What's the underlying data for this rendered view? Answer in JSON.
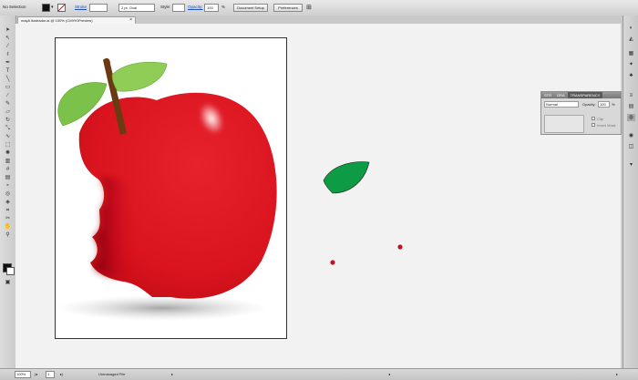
{
  "control_bar": {
    "selection_label": "No Selection",
    "stroke_label": "Stroke",
    "brush_value": "2 pt. Oval",
    "style_label": "Style:",
    "opacity_label": "Opacity:",
    "opacity_value": "100",
    "percent": "%",
    "document_setup": "Document Setup",
    "preferences": "Preferences"
  },
  "document_tab": {
    "title": "maçã ilustrador.ai @ 100% (CMYK/Preview)",
    "close": "×"
  },
  "transparency_panel": {
    "tabs": [
      "STR",
      "GRA",
      "TRANSPARENCY"
    ],
    "mode": "Normal",
    "opacity_label": "Opacity:",
    "opacity_value": "100",
    "percent": "%",
    "clip_label": "Clip",
    "invert_mask_label": "Invert Mask"
  },
  "status_bar": {
    "zoom": "100%",
    "page": "1",
    "file_status": "Unmanaged File"
  },
  "colors": {
    "apple_red": "#d9141f",
    "apple_shadow": "#8e0008",
    "leaf_green": "#7cc24a",
    "loose_leaf_green": "#0e9b45",
    "stem_brown": "#6b3a12",
    "fill_black": "#111111"
  },
  "icons": {
    "tools": [
      "selection-arrow-icon",
      "direct-selection-icon",
      "magic-wand-icon",
      "lasso-icon",
      "pen-icon",
      "type-icon",
      "line-icon",
      "rectangle-icon",
      "paintbrush-icon",
      "pencil-icon",
      "eraser-icon",
      "rotate-icon",
      "scale-icon",
      "warp-icon",
      "free-transform-icon",
      "symbol-sprayer-icon",
      "graph-icon",
      "mesh-icon",
      "gradient-icon",
      "eyedropper-icon",
      "blend-icon",
      "live-paint-icon",
      "slice-icon",
      "scissors-icon",
      "hand-icon",
      "zoom-icon"
    ],
    "dock": [
      "color-icon",
      "color-guide-icon",
      "swatches-icon",
      "brushes-icon",
      "symbols-icon",
      "stroke-icon",
      "gradient-panel-icon",
      "transparency-icon",
      "appearance-icon",
      "layers-icon"
    ]
  }
}
